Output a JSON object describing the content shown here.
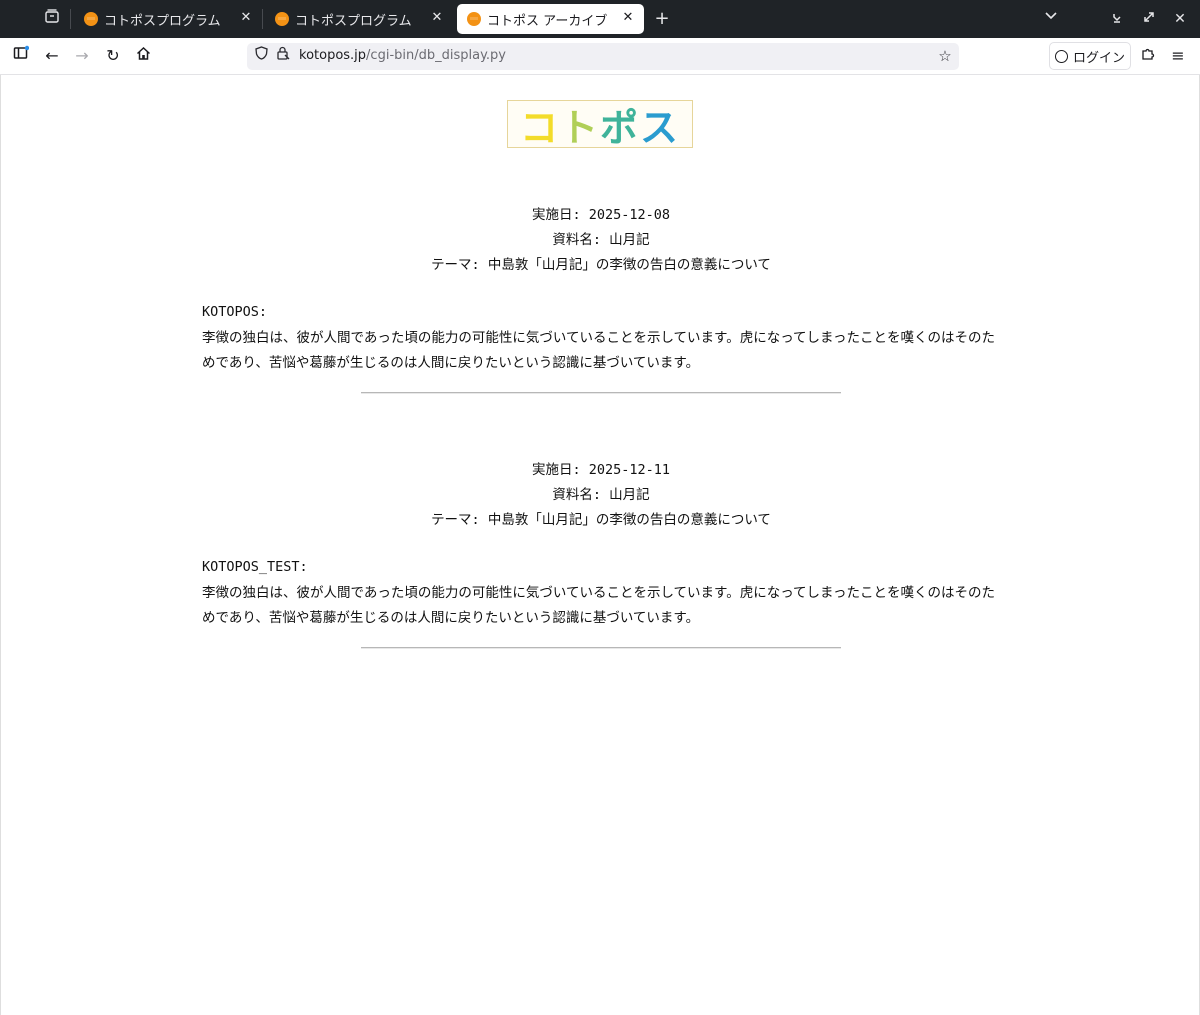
{
  "browser": {
    "tabs": [
      {
        "title": "コトポスプログラム",
        "active": false
      },
      {
        "title": "コトポスプログラム",
        "active": false
      },
      {
        "title": "コトポス アーカイブ",
        "active": true
      }
    ],
    "url_host": "kotopos.jp",
    "url_path": "/cgi-bin/db_display.py",
    "login_label": "ログイン"
  },
  "logo": {
    "text": [
      "コ",
      "ト",
      "ポ",
      "ス"
    ]
  },
  "entries": [
    {
      "date_label": "実施日: 2025-12-08",
      "material_label": "資料名: ",
      "material": "山月記",
      "theme_label": "テーマ: ",
      "theme": "中島敦「山月記」の李徴の告白の意義について",
      "author": "KOTOPOS:",
      "body": "李徴の独白は、彼が人間であった頃の能力の可能性に気づいていることを示しています。虎になってしまったことを嘆くのはそのためであり、苦悩や葛藤が生じるのは人間に戻りたいという認識に基づいています。"
    },
    {
      "date_label": "実施日: 2025-12-11",
      "material_label": "資料名: ",
      "material": "山月記",
      "theme_label": "テーマ: ",
      "theme": "中島敦「山月記」の李徴の告白の意義について",
      "author": "KOTOPOS_TEST:",
      "body": "李徴の独白は、彼が人間であった頃の能力の可能性に気づいていることを示しています。虎になってしまったことを嘆くのはそのためであり、苦悩や葛藤が生じるのは人間に戻りたいという認識に基づいています。"
    }
  ],
  "colors": {
    "tabbar": "#1f2327",
    "favicon": "#f39215",
    "rule": "#b7b7b7"
  }
}
